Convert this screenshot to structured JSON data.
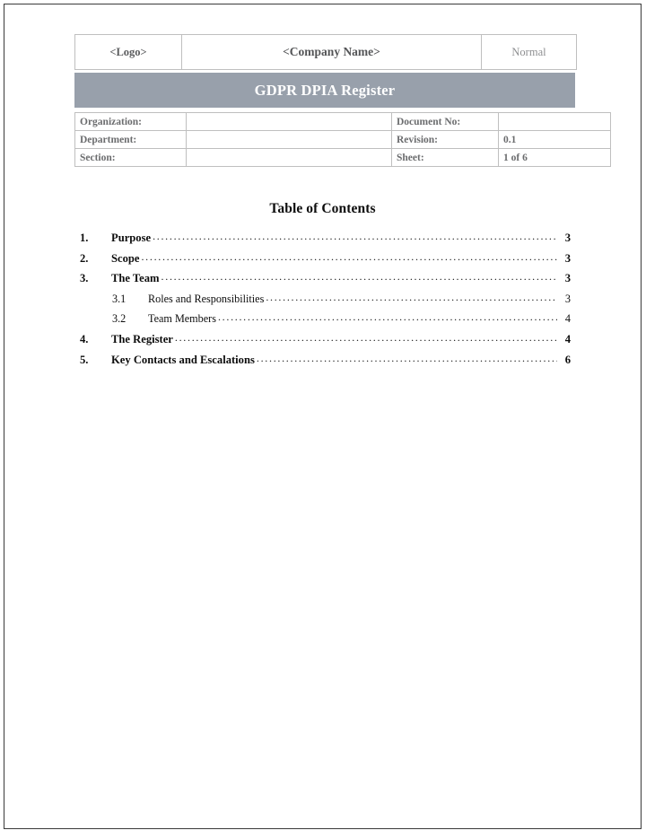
{
  "document": {
    "header": {
      "logo_placeholder": "<Logo>",
      "company_placeholder": "<Company Name>",
      "classification": "Normal",
      "banner_title": "GDPR DPIA Register",
      "banner_color": "#98a0ab",
      "meta_rows": [
        {
          "label": "Organization:",
          "value": "",
          "label2": "Document No:",
          "value2": ""
        },
        {
          "label": "Department:",
          "value": "",
          "label2": "Revision:",
          "value2": "0.1"
        },
        {
          "label": "Section:",
          "value": "",
          "label2": "Sheet:",
          "value2": "1 of 6"
        }
      ]
    },
    "toc": {
      "heading": "Table of Contents",
      "entries": [
        {
          "number": "1.",
          "label": "Purpose",
          "page": "3",
          "level": 1
        },
        {
          "number": "2.",
          "label": "Scope",
          "page": "3",
          "level": 1
        },
        {
          "number": "3.",
          "label": "The Team",
          "page": "3",
          "level": 1
        },
        {
          "number": "3.1",
          "label": "Roles and Responsibilities",
          "page": "3",
          "level": 2
        },
        {
          "number": "3.2",
          "label": "Team Members",
          "page": "4",
          "level": 2
        },
        {
          "number": "4.",
          "label": "The Register",
          "page": "4",
          "level": 1
        },
        {
          "number": "5.",
          "label": "Key Contacts and Escalations",
          "page": "6",
          "level": 1
        }
      ],
      "leader_char": "."
    }
  }
}
